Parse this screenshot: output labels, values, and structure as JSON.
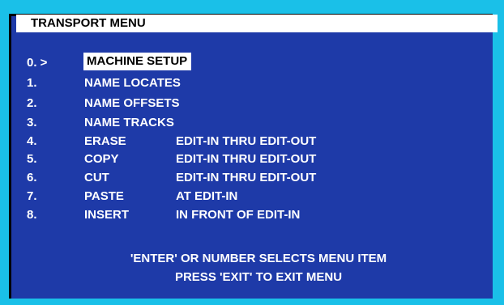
{
  "menu": {
    "title": "TRANSPORT MENU",
    "items": [
      {
        "num": "0. >",
        "label": "MACHINE SETUP",
        "desc": ""
      },
      {
        "num": "1.",
        "label": "NAME LOCATES",
        "desc": ""
      },
      {
        "num": "2.",
        "label": "NAME OFFSETS",
        "desc": ""
      },
      {
        "num": "3.",
        "label": "NAME TRACKS",
        "desc": ""
      },
      {
        "num": "4.",
        "label": "ERASE",
        "desc": "EDIT-IN THRU EDIT-OUT"
      },
      {
        "num": "5.",
        "label": "COPY",
        "desc": "EDIT-IN THRU EDIT-OUT"
      },
      {
        "num": "6.",
        "label": "CUT",
        "desc": "EDIT-IN THRU EDIT-OUT"
      },
      {
        "num": "7.",
        "label": "PASTE",
        "desc": "AT EDIT-IN"
      },
      {
        "num": "8.",
        "label": "INSERT",
        "desc": "IN FRONT OF EDIT-IN"
      }
    ],
    "footer_line1": "'ENTER' OR NUMBER SELECTS MENU ITEM",
    "footer_line2": "PRESS 'EXIT' TO EXIT MENU"
  },
  "colors": {
    "frame": "#1ac0e8",
    "screen": "#1e3aa8",
    "text": "#ffffff",
    "highlight": "#ffffff"
  }
}
